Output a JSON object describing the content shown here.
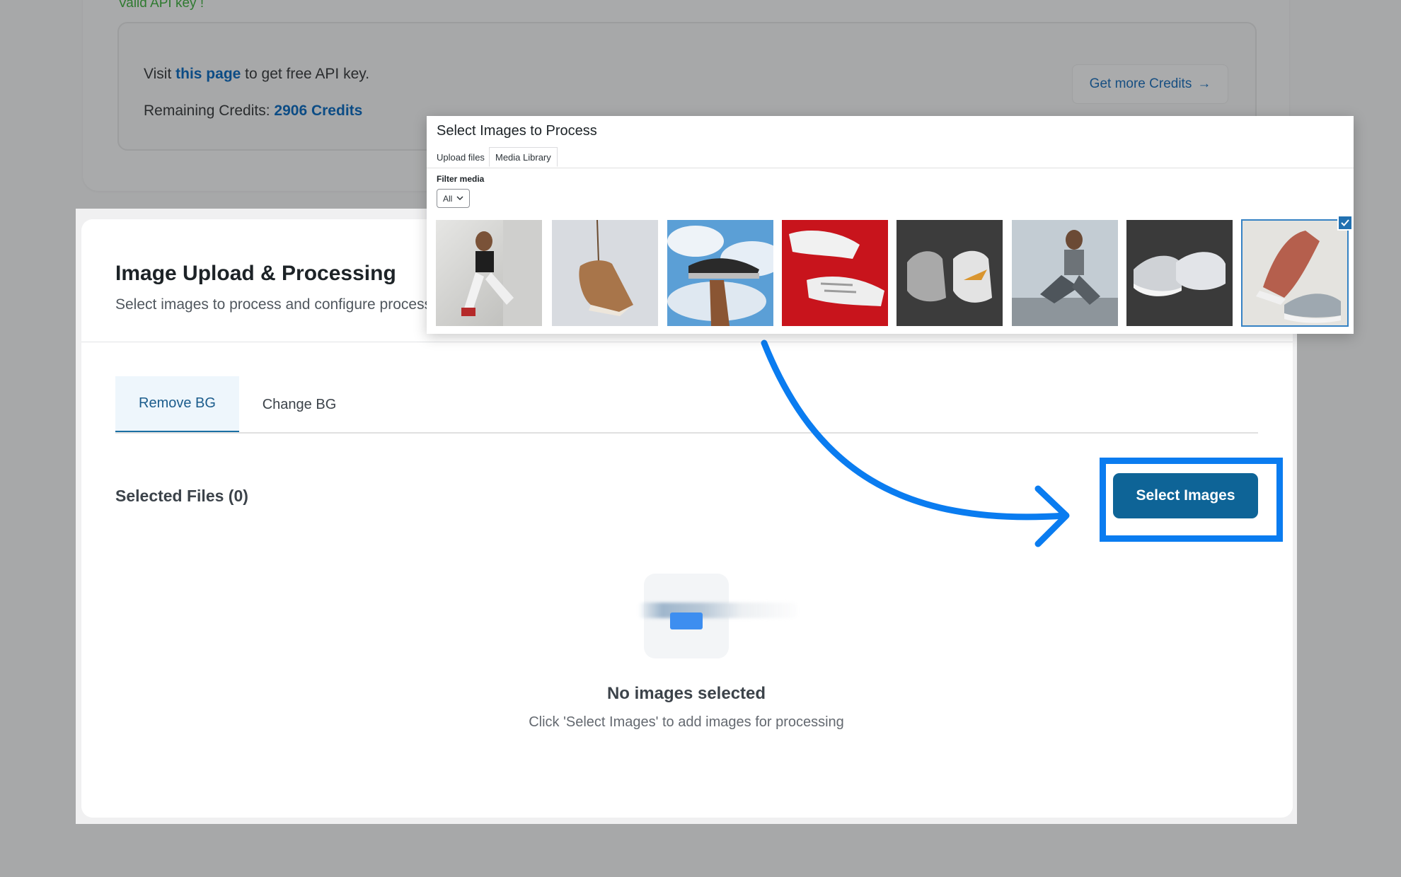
{
  "api_section": {
    "valid_key": "Valid API key !",
    "visit_prefix": "Visit",
    "visit_link": "this page",
    "visit_suffix": "to get free API key.",
    "credits_label": "Remaining Credits:",
    "credits_value": "2906 Credits",
    "get_more_credits": "Get more Credits",
    "get_more_arrow": "→"
  },
  "main": {
    "title": "Image Upload & Processing",
    "subtitle": "Select images to process and configure process",
    "tabs": [
      {
        "label": "Remove BG",
        "active": true
      },
      {
        "label": "Change BG",
        "active": false
      }
    ],
    "selected_files": "Selected Files (0)",
    "select_button": "Select Images",
    "empty_title": "No images selected",
    "empty_subtitle": "Click 'Select Images' to add images for processing"
  },
  "modal": {
    "title": "Select Images to Process",
    "tabs": [
      "Upload files",
      "Media Library"
    ],
    "filter_label": "Filter media",
    "filter_value": "All",
    "thumbnails": [
      {
        "icon": "woman-fitness-photo"
      },
      {
        "icon": "brown-shoe-hanging-photo"
      },
      {
        "icon": "sneaker-sky-photo"
      },
      {
        "icon": "white-sneakers-red-photo"
      },
      {
        "icon": "nike-sneakers-dark-photo"
      },
      {
        "icon": "woman-sitting-photo"
      },
      {
        "icon": "grey-sneakers-dark-photo"
      },
      {
        "icon": "red-grey-sneakers-photo",
        "selected": true
      }
    ]
  },
  "colors": {
    "primary": "#0e6497",
    "highlight": "#0a7cf0",
    "link": "#0c4c85",
    "success": "#2f7a30"
  }
}
